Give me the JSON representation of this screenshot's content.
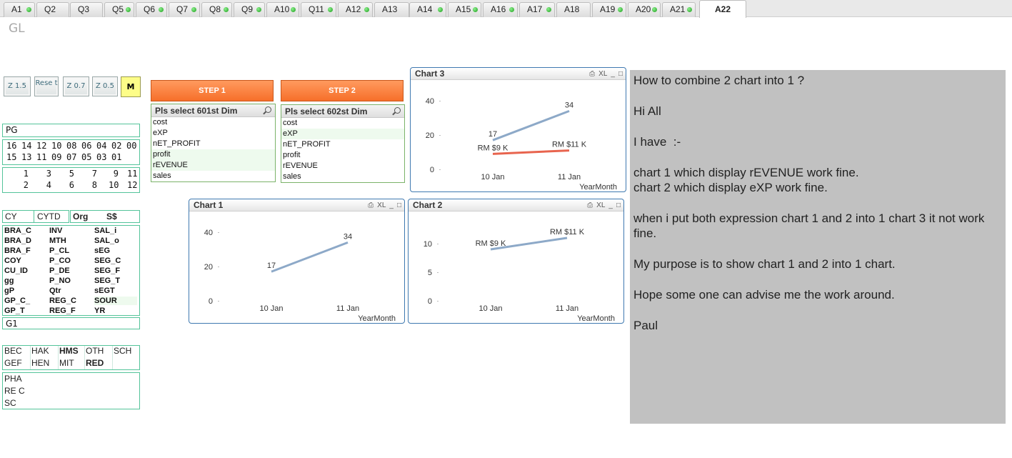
{
  "tabs": [
    {
      "label": "A1",
      "dot": true
    },
    {
      "label": "Q2",
      "dot": false
    },
    {
      "label": "Q3",
      "dot": false
    },
    {
      "label": "Q5",
      "dot": true
    },
    {
      "label": "Q6",
      "dot": true
    },
    {
      "label": "Q7",
      "dot": true
    },
    {
      "label": "Q8",
      "dot": true
    },
    {
      "label": "Q9",
      "dot": true
    },
    {
      "label": "A10",
      "dot": true
    },
    {
      "label": "Q11",
      "dot": true
    },
    {
      "label": "A12",
      "dot": true
    },
    {
      "label": "A13",
      "dot": false
    },
    {
      "label": "A14",
      "dot": true
    },
    {
      "label": "A15",
      "dot": true
    },
    {
      "label": "A16",
      "dot": true
    },
    {
      "label": "A17",
      "dot": true
    },
    {
      "label": "A18",
      "dot": false
    },
    {
      "label": "A19",
      "dot": true
    },
    {
      "label": "A20",
      "dot": true
    },
    {
      "label": "A21",
      "dot": true
    },
    {
      "label": "A22",
      "dot": false,
      "active": true
    }
  ],
  "app_title": "GL",
  "zoom_buttons": [
    "Z 1.5",
    "Rese t",
    "Z 0.7",
    "Z 0.5"
  ],
  "m_button": "M",
  "pg": {
    "label": "PG",
    "row1": [
      "16",
      "14",
      "12",
      "10",
      "08",
      "06",
      "04",
      "02",
      "00"
    ],
    "row2": [
      "15",
      "13",
      "11",
      "09",
      "07",
      "05",
      "03",
      "01"
    ]
  },
  "numbers": {
    "row1": [
      "1",
      "3",
      "5",
      "7",
      "9",
      "11"
    ],
    "row2": [
      "2",
      "4",
      "6",
      "8",
      "10",
      "12"
    ]
  },
  "cy_bar": {
    "cy": "CY",
    "cytd": "CYTD",
    "org": "Org",
    "currency": "S$"
  },
  "fields": {
    "col1": [
      "BRA_C",
      "BRA_D",
      "BRA_F",
      "COY",
      "CU_ID",
      "gg",
      "gP",
      "GP_C_",
      "GP_T"
    ],
    "col2": [
      "INV",
      "MTH",
      "P_CL",
      "P_CO",
      "P_DE",
      "P_NO",
      "Qtr",
      "REG_C",
      "REG_F"
    ],
    "col3": [
      "SAL_i",
      "SAL_o",
      "sEG",
      "SEG_C",
      "SEG_F",
      "SEG_T",
      "sEGT",
      "SOUR",
      "YR"
    ]
  },
  "g1": "G1",
  "codes": {
    "row1": [
      "BEC",
      "HAK",
      "HMS",
      "OTH",
      "SCH"
    ],
    "row2": [
      "GEF",
      "HEN",
      "MIT",
      "RED"
    ]
  },
  "codes2": [
    "PHA",
    "RE C",
    "SC"
  ],
  "step1": {
    "label": "STEP 1",
    "list_title": "Pls select 601st Dim",
    "items": [
      "cost",
      "eXP",
      "nET_PROFIT",
      "profit",
      "rEVENUE",
      "sales"
    ]
  },
  "step2": {
    "label": "STEP 2",
    "list_title": "Pls select 602st Dim",
    "items": [
      "cost",
      "eXP",
      "nET_PROFIT",
      "profit",
      "rEVENUE",
      "sales"
    ]
  },
  "chart_icons": {
    "print": "⎙",
    "xl": "XL",
    "min": "_",
    "max": "□"
  },
  "chart_data": [
    {
      "title": "Chart 3",
      "type": "line",
      "categories": [
        "10 Jan",
        "11 Jan"
      ],
      "xlabel": "YearMonth",
      "ylim": [
        0,
        40
      ],
      "yticks": [
        0,
        20,
        40
      ],
      "series": [
        {
          "values": [
            17,
            34
          ],
          "labels": [
            "17",
            "34"
          ],
          "color": "#8da9c8"
        },
        {
          "values": [
            9,
            11
          ],
          "labels": [
            "RM $9 K",
            "RM $11 K"
          ],
          "color": "#e8644e"
        }
      ]
    },
    {
      "title": "Chart 1",
      "type": "line",
      "categories": [
        "10 Jan",
        "11 Jan"
      ],
      "xlabel": "YearMonth",
      "ylim": [
        0,
        40
      ],
      "yticks": [
        0,
        20,
        40
      ],
      "series": [
        {
          "values": [
            17,
            34
          ],
          "labels": [
            "17",
            "34"
          ],
          "color": "#8da9c8"
        }
      ]
    },
    {
      "title": "Chart 2",
      "type": "line",
      "categories": [
        "10 Jan",
        "11 Jan"
      ],
      "xlabel": "YearMonth",
      "ylim": [
        0,
        12
      ],
      "yticks": [
        0,
        5,
        10
      ],
      "series": [
        {
          "values": [
            9,
            11
          ],
          "labels": [
            "RM $9 K",
            "RM $11 K"
          ],
          "color": "#8da9c8"
        }
      ]
    }
  ],
  "note": [
    "How to combine 2 chart into 1 ?",
    "Hi All",
    "I have  :-",
    "chart 1 which display rEVENUE work fine.\nchart 2 which display eXP work fine.",
    "when i put both expression chart 1 and 2 into 1 chart 3 it not work fine.",
    "My purpose is to show chart 1 and 2 into 1 chart.",
    "Hope some one can advise me the work around.",
    "Paul"
  ]
}
